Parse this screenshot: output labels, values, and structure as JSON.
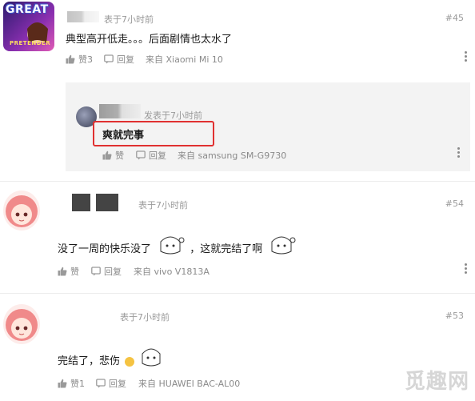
{
  "comments": [
    {
      "time": "表于7小时前",
      "floor": "#45",
      "content": "典型高开低走。。。后面剧情也太水了",
      "like_label": "赞3",
      "reply_label": "回复",
      "device": "来自 Xiaomi Mi 10",
      "avatar_text": [
        "GREAT",
        "PRETENDER"
      ]
    },
    {
      "time": "表于7小时前",
      "floor": "#54",
      "content_parts": [
        "没了一周的快乐没了",
        "，这就完结了啊"
      ],
      "like_label": "赞",
      "reply_label": "回复",
      "device": "来自 vivo V1813A"
    },
    {
      "time": "表于7小时前",
      "floor": "#53",
      "content": "完结了，悲伤",
      "like_label": "赞1",
      "reply_label": "回复",
      "device": "来自 HUAWEI BAC-AL00"
    }
  ],
  "reply": {
    "time": "发表于7小时前",
    "content": "爽就完事",
    "like_label": "赞",
    "reply_label": "回复",
    "device": "来自 samsung SM-G9730"
  },
  "watermark": "觅趣网",
  "colors": {
    "highlight_box": "#e03030",
    "reply_bg": "#f3f3f3",
    "watermark": "#d6d6d6"
  }
}
